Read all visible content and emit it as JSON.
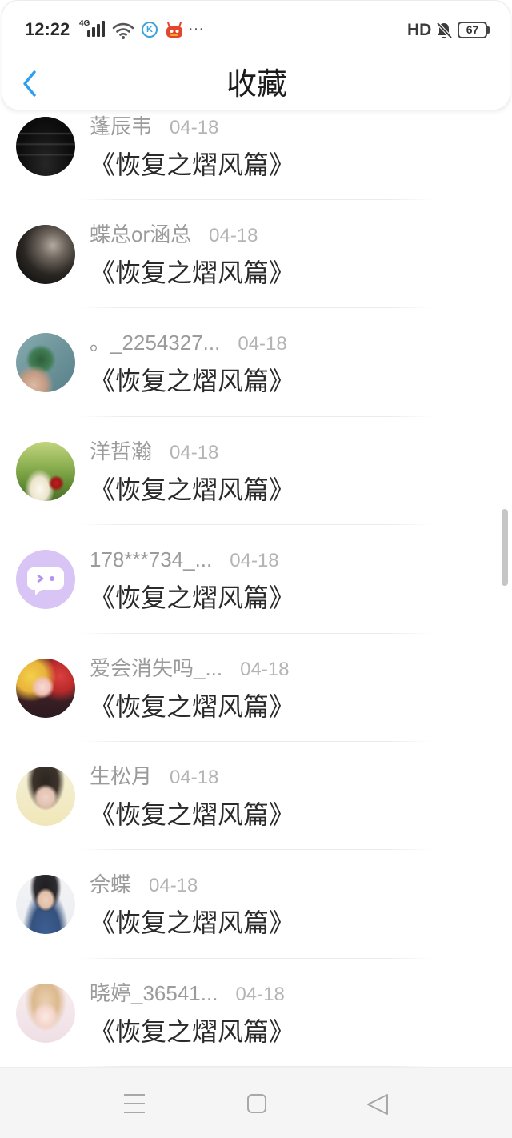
{
  "status_bar": {
    "time": "12:22",
    "network": "4G",
    "k_app_letter": "K",
    "more": "···",
    "hd": "HD",
    "battery": "67",
    "icons": [
      "signal-icon",
      "wifi-icon",
      "k-app-icon",
      "robot-app-icon",
      "bell-off-icon",
      "battery-icon"
    ]
  },
  "header": {
    "title": "收藏",
    "back_icon": "chevron-left-icon"
  },
  "favorites": [
    {
      "name": "蓬辰韦",
      "date": "04-18",
      "title": "《恢复之熠风篇》"
    },
    {
      "name": "蝶总or涵总",
      "date": "04-18",
      "title": "《恢复之熠风篇》"
    },
    {
      "name": "。_2254327...",
      "date": "04-18",
      "title": "《恢复之熠风篇》"
    },
    {
      "name": "洋哲瀚",
      "date": "04-18",
      "title": "《恢复之熠风篇》"
    },
    {
      "name": "178***734_...",
      "date": "04-18",
      "title": "《恢复之熠风篇》",
      "avatar_icon": "chat-bubble-face-icon"
    },
    {
      "name": "爱会消失吗_...",
      "date": "04-18",
      "title": "《恢复之熠风篇》"
    },
    {
      "name": "生松月",
      "date": "04-18",
      "title": "《恢复之熠风篇》"
    },
    {
      "name": "佘蝶",
      "date": "04-18",
      "title": "《恢复之熠风篇》"
    },
    {
      "name": "晓婷_36541...",
      "date": "04-18",
      "title": "《恢复之熠风篇》"
    }
  ],
  "nav_bar": {
    "icons": [
      "menu-icon",
      "home-square-icon",
      "back-triangle-icon"
    ]
  },
  "colors": {
    "accent": "#2d9ff2",
    "title_text": "#2a2a2a",
    "name_text": "#9b9b9b",
    "date_text": "#b4b4b4",
    "avatar_purple": "#d8c4f5"
  }
}
